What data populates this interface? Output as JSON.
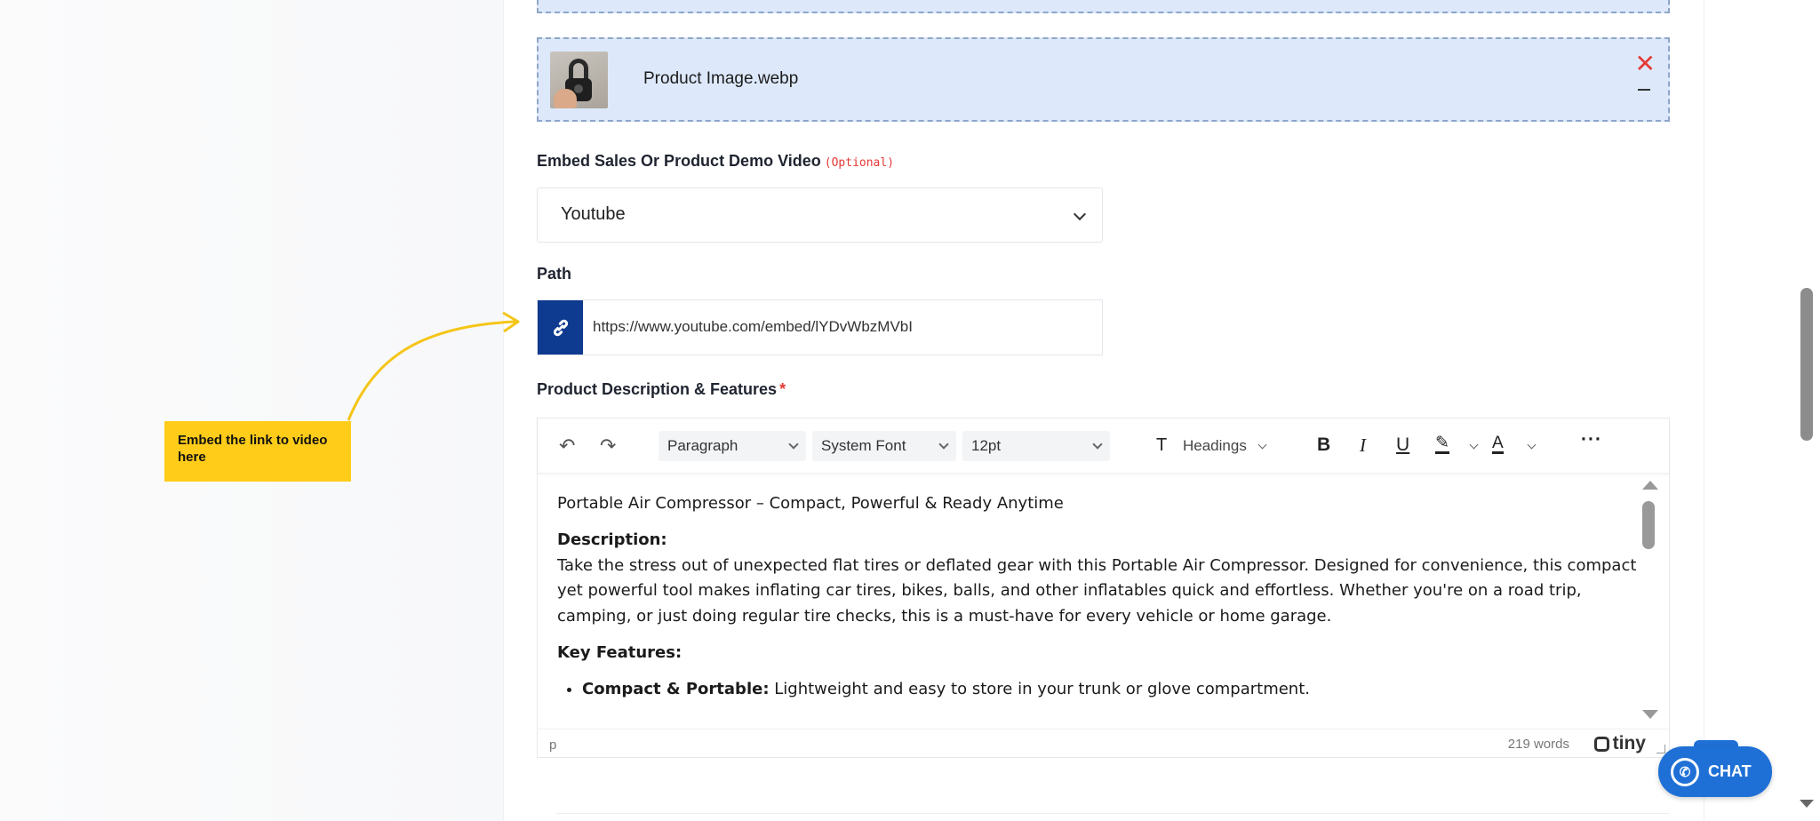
{
  "upload": {
    "file_name": "Product Image.webp",
    "close_glyph": "✕"
  },
  "video": {
    "label": "Embed Sales Or Product Demo Video",
    "optional": "(Optional)",
    "selected": "Youtube"
  },
  "path": {
    "label": "Path",
    "value": "https://www.youtube.com/embed/lYDvWbzMVbI"
  },
  "callout": {
    "text": "Embed the link to video here",
    "color": "#ffcc1a"
  },
  "description": {
    "label": "Product Description & Features",
    "required": "*",
    "toolbar": {
      "block_format": "Paragraph",
      "font_family": "System Font",
      "font_size": "12pt",
      "headings": "Headings"
    },
    "content": {
      "title": "Portable Air Compressor – Compact, Powerful & Ready Anytime",
      "desc_heading": "Description:",
      "desc_body": "Take the stress out of unexpected flat tires or deflated gear with this Portable Air Compressor. Designed for convenience, this compact yet powerful tool makes inflating car tires, bikes, balls, and other inflatables quick and effortless. Whether you're on a road trip, camping, or just doing regular tire checks, this is a must-have for every vehicle or home garage.",
      "features_heading": "Key Features:",
      "features": [
        {
          "title": "Compact & Portable:",
          "text": "Lightweight and easy to store in your trunk or glove compartment."
        }
      ]
    },
    "status": {
      "path": "p",
      "word_count": "219 words",
      "brand": "tiny"
    }
  },
  "chat": {
    "label": "CHAT"
  },
  "colors": {
    "accent": "#0e3a8f",
    "chat": "#1f70d6",
    "upload_bg": "#dde9fb",
    "error": "#e53935"
  }
}
